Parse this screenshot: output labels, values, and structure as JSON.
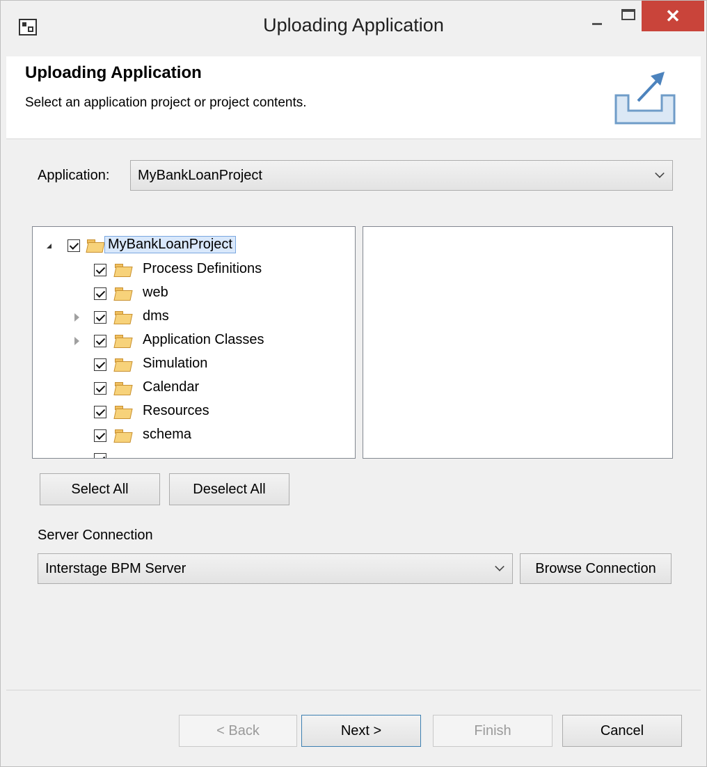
{
  "window": {
    "title": "Uploading Application",
    "close_glyph": "✕"
  },
  "header": {
    "title": "Uploading Application",
    "description": "Select an application project or project contents.",
    "icon": "export-icon"
  },
  "application": {
    "label": "Application:",
    "value": "MyBankLoanProject"
  },
  "tree": {
    "root": {
      "label": "MyBankLoanProject",
      "checked": true,
      "expanded": true
    },
    "items": [
      {
        "label": "Process Definitions",
        "checked": true,
        "expandable": false
      },
      {
        "label": "web",
        "checked": true,
        "expandable": false
      },
      {
        "label": "dms",
        "checked": true,
        "expandable": true
      },
      {
        "label": "Application Classes",
        "checked": true,
        "expandable": true
      },
      {
        "label": "Simulation",
        "checked": true,
        "expandable": false
      },
      {
        "label": "Calendar",
        "checked": true,
        "expandable": false
      },
      {
        "label": "Resources",
        "checked": true,
        "expandable": false
      },
      {
        "label": "schema",
        "checked": true,
        "expandable": false
      }
    ]
  },
  "selection_buttons": {
    "select_all": "Select All",
    "deselect_all": "Deselect All"
  },
  "server": {
    "label": "Server Connection",
    "value": "Interstage BPM Server",
    "browse_label": "Browse Connection"
  },
  "footer": {
    "back": "< Back",
    "next": "Next >",
    "finish": "Finish",
    "cancel": "Cancel"
  }
}
